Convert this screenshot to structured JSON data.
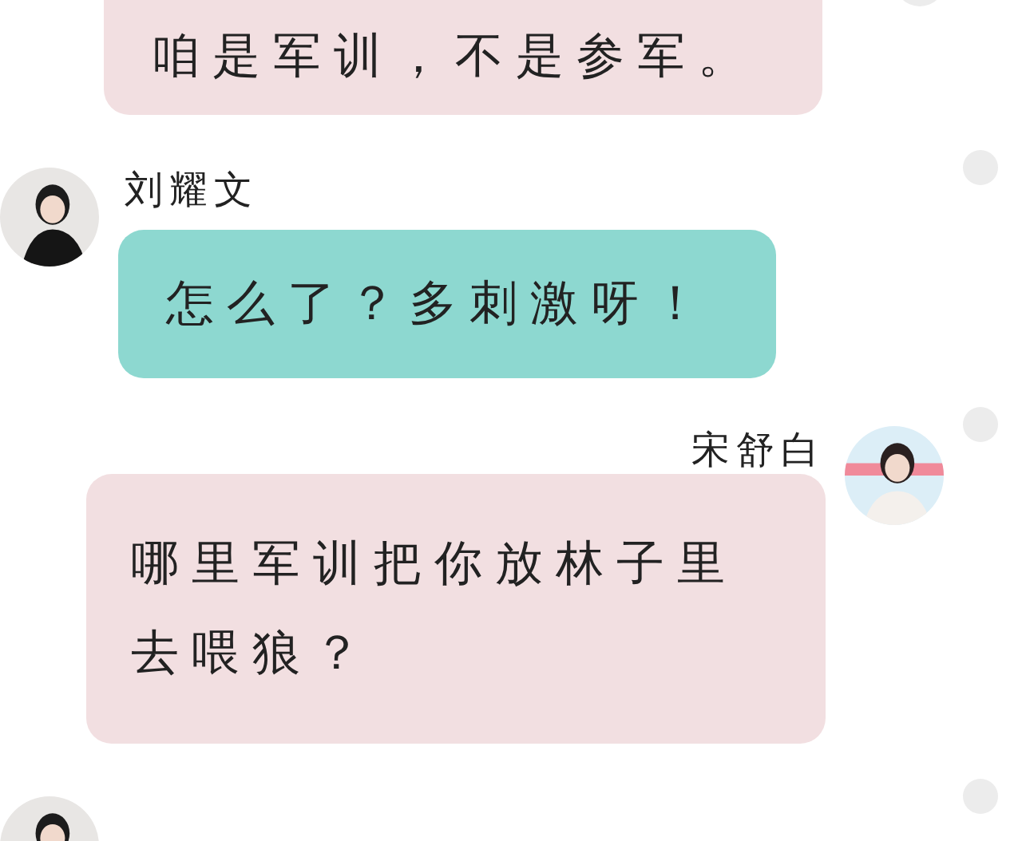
{
  "messages": [
    {
      "kind": "outgoing",
      "lines": [
        "咱是军训，不是参军。"
      ],
      "color": "#f2dfe1"
    },
    {
      "kind": "incoming",
      "sender": "刘耀文",
      "lines": [
        "怎么了？多刺激呀！"
      ],
      "color": "#8dd8d0"
    },
    {
      "kind": "outgoing",
      "sender": "宋舒白",
      "lines": [
        "哪里军训把你放林子里",
        "去喂狼？"
      ],
      "color": "#f2dfe1"
    },
    {
      "kind": "incoming"
    }
  ]
}
